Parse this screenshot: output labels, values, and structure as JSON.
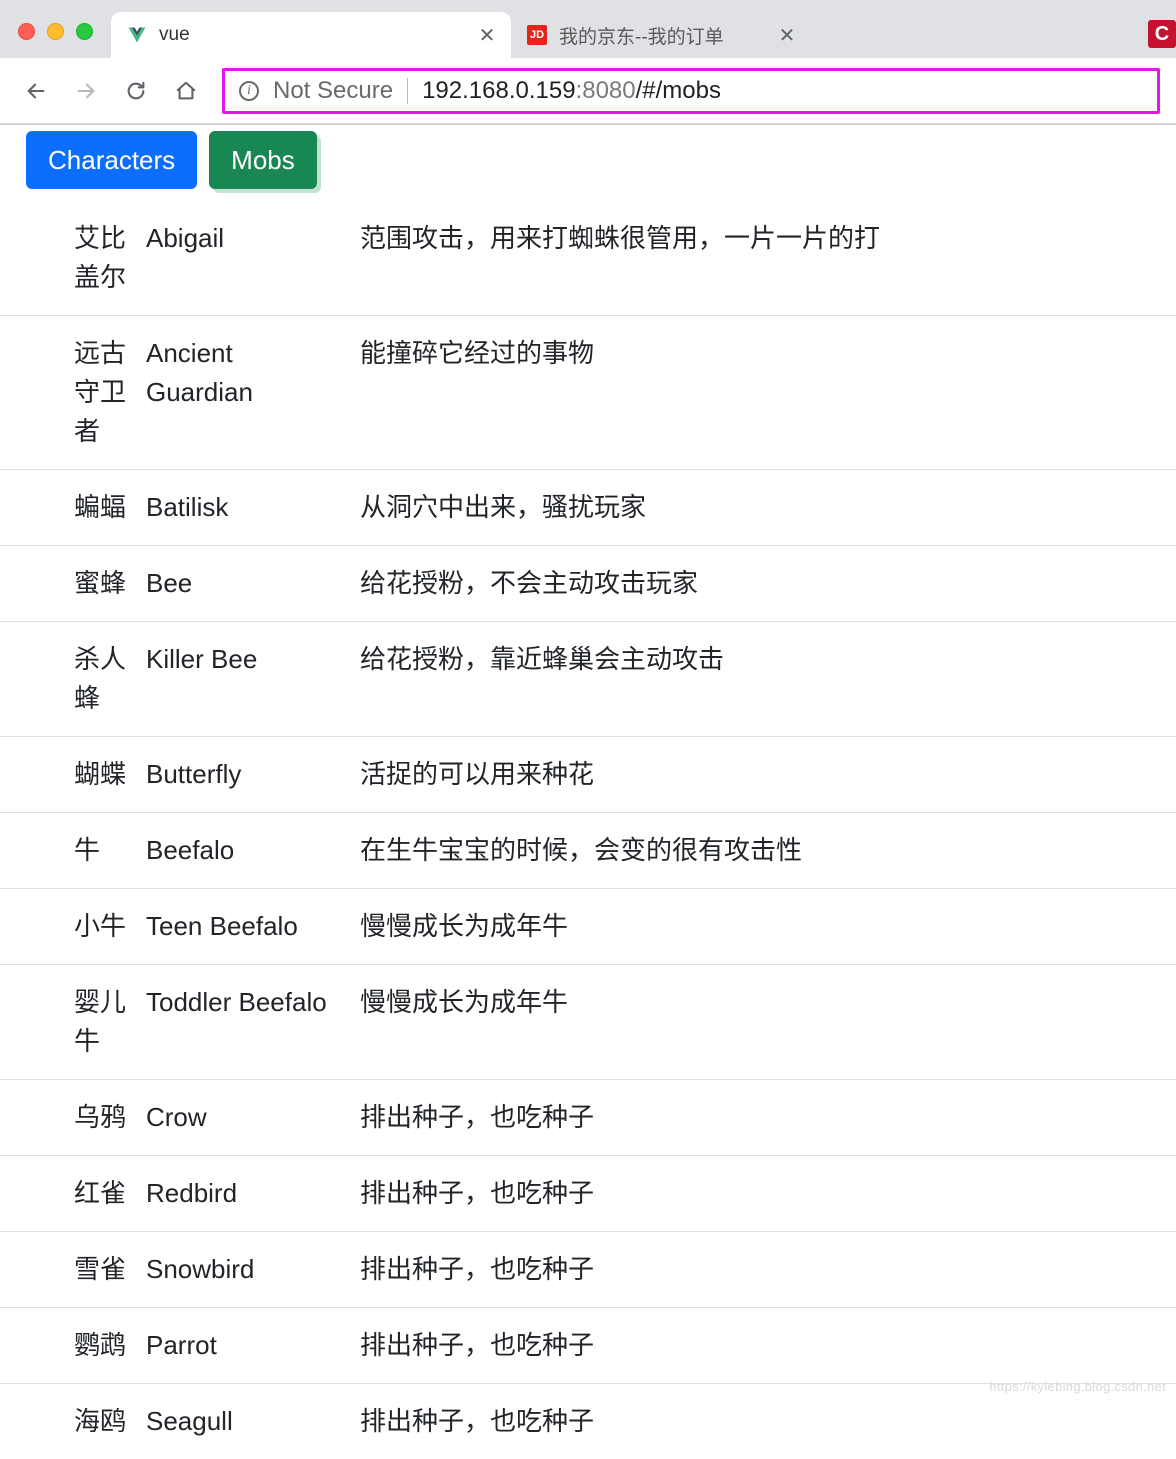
{
  "chrome": {
    "tabs": [
      {
        "title": "vue",
        "favicon": "vue",
        "active": true
      },
      {
        "title": "我的京东--我的订单",
        "favicon": "JD",
        "active": false
      }
    ],
    "address": {
      "not_secure_label": "Not Secure",
      "host": "192.168.0.159",
      "port": ":8080",
      "path": "/#/mobs"
    },
    "ext_label": "C"
  },
  "nav": {
    "tab_characters": "Characters",
    "tab_mobs": "Mobs"
  },
  "mobs": [
    {
      "cn": "艾比盖尔",
      "en": "Abigail",
      "desc": "范围攻击，用来打蜘蛛很管用，一片一片的打"
    },
    {
      "cn": "远古守卫者",
      "en": "Ancient Guardian",
      "desc": "能撞碎它经过的事物"
    },
    {
      "cn": "蝙蝠",
      "en": "Batilisk",
      "desc": "从洞穴中出来，骚扰玩家"
    },
    {
      "cn": "蜜蜂",
      "en": "Bee",
      "desc": "给花授粉，不会主动攻击玩家"
    },
    {
      "cn": "杀人蜂",
      "en": "Killer Bee",
      "desc": "给花授粉，靠近蜂巢会主动攻击"
    },
    {
      "cn": "蝴蝶",
      "en": "Butterfly",
      "desc": "活捉的可以用来种花"
    },
    {
      "cn": "牛",
      "en": "Beefalo",
      "desc": "在生牛宝宝的时候，会变的很有攻击性"
    },
    {
      "cn": "小牛",
      "en": "Teen Beefalo",
      "desc": "慢慢成长为成年牛"
    },
    {
      "cn": "婴儿牛",
      "en": "Toddler Beefalo",
      "desc": "慢慢成长为成年牛"
    },
    {
      "cn": "乌鸦",
      "en": "Crow",
      "desc": "排出种子，也吃种子"
    },
    {
      "cn": "红雀",
      "en": "Redbird",
      "desc": "排出种子，也吃种子"
    },
    {
      "cn": "雪雀",
      "en": "Snowbird",
      "desc": "排出种子，也吃种子"
    },
    {
      "cn": "鹦鹉",
      "en": "Parrot",
      "desc": "排出种子，也吃种子"
    },
    {
      "cn": "海鸥",
      "en": "Seagull",
      "desc": "排出种子，也吃种子"
    }
  ],
  "watermark": "https://kylebing.blog.csdn.net"
}
